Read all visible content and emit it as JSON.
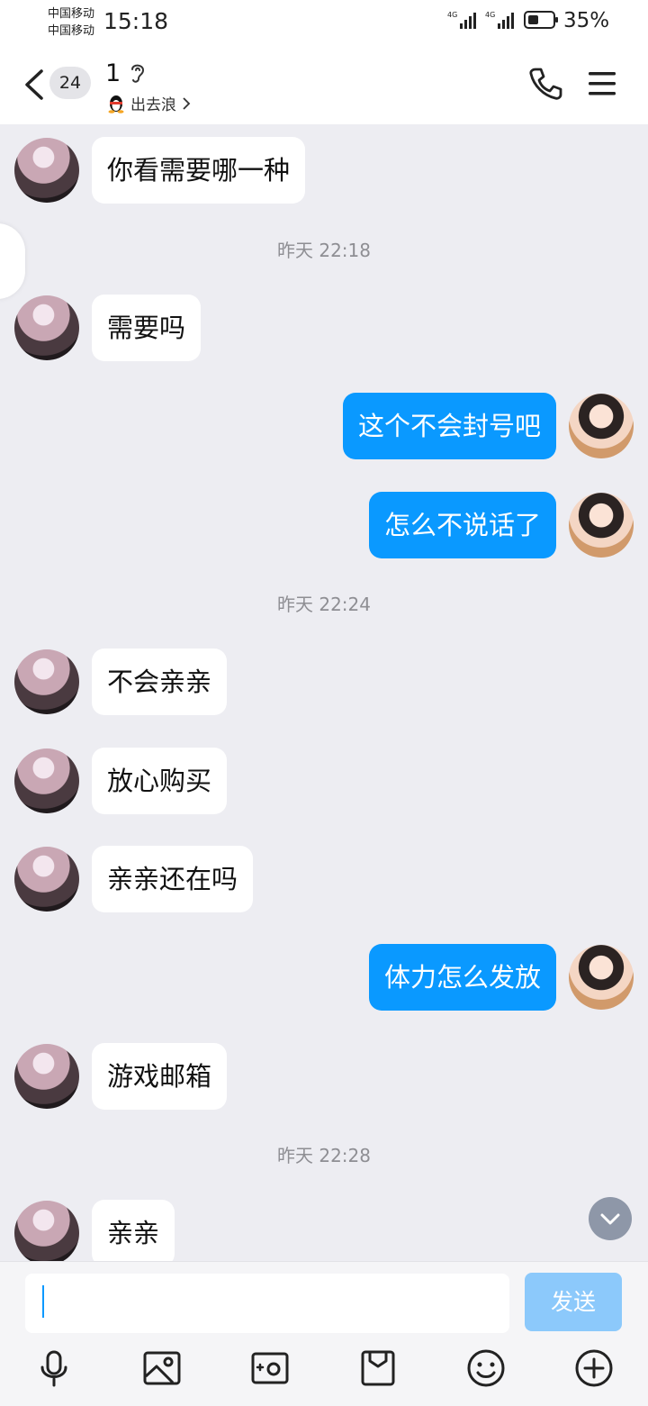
{
  "status": {
    "carrier1": "中国移动",
    "carrier2": "中国移动",
    "time": "15:18",
    "battery": "35%"
  },
  "header": {
    "unread": "24",
    "title": "1",
    "subtitle": "出去浪"
  },
  "messages": [
    {
      "side": "left",
      "text": "你看需要哪一种"
    },
    {
      "time": "昨天 22:18"
    },
    {
      "side": "left",
      "text": "需要吗"
    },
    {
      "side": "right",
      "text": "这个不会封号吧"
    },
    {
      "side": "right",
      "text": "怎么不说话了"
    },
    {
      "time": "昨天 22:24"
    },
    {
      "side": "left",
      "text": "不会亲亲"
    },
    {
      "side": "left",
      "text": "放心购买"
    },
    {
      "side": "left",
      "text": "亲亲还在吗"
    },
    {
      "side": "right",
      "text": "体力怎么发放"
    },
    {
      "side": "left",
      "text": "游戏邮箱"
    },
    {
      "time": "昨天 22:28"
    },
    {
      "side": "left",
      "text": "亲亲"
    }
  ],
  "input": {
    "value": "",
    "send_label": "发送"
  },
  "toolbar": [
    "mic-icon",
    "image-icon",
    "camera-icon",
    "file-icon",
    "emoji-icon",
    "plus-icon"
  ],
  "colors": {
    "accent": "#0A99FF",
    "background": "#EDEDF2"
  }
}
